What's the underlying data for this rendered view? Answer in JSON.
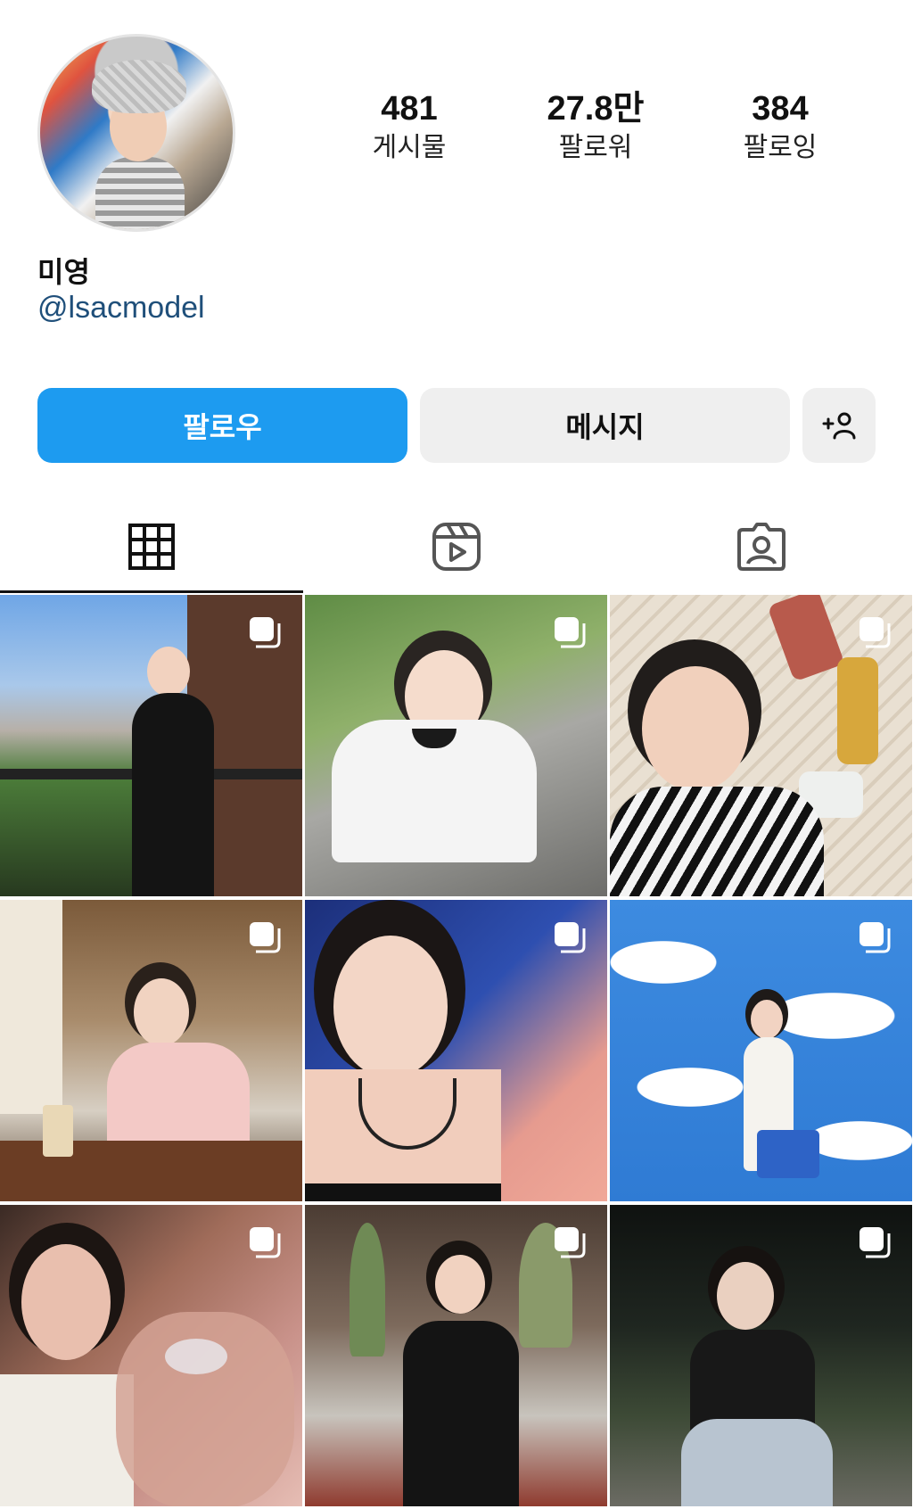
{
  "profile": {
    "name": "미영",
    "handle": "@lsacmodel",
    "avatar_icon": "profile-photo"
  },
  "stats": [
    {
      "value": "481",
      "label": "게시물"
    },
    {
      "value": "27.8만",
      "label": "팔로워"
    },
    {
      "value": "384",
      "label": "팔로잉"
    }
  ],
  "buttons": {
    "follow": "팔로우",
    "message": "메시지",
    "add_user_icon": "person-add-icon"
  },
  "tabs": [
    {
      "icon": "grid-icon",
      "active": true
    },
    {
      "icon": "reels-icon",
      "active": false
    },
    {
      "icon": "tagged-icon",
      "active": false
    }
  ],
  "colors": {
    "follow_bg": "#1d9bf0",
    "handle": "#1f4f7a",
    "secondary_bg": "#efefef"
  },
  "posts": [
    {
      "multi": true,
      "scene": "balcony-city-black-dress"
    },
    {
      "multi": true,
      "scene": "street-white-tee-smile"
    },
    {
      "multi": true,
      "scene": "wink-striped-with-bottles"
    },
    {
      "multi": true,
      "scene": "cafe-pink-dress"
    },
    {
      "multi": true,
      "scene": "blue-closeup-necklace"
    },
    {
      "multi": true,
      "scene": "clouds-room-white-dress"
    },
    {
      "multi": true,
      "scene": "blurry-close-selfie"
    },
    {
      "multi": true,
      "scene": "sitting-black-dress-plants"
    },
    {
      "multi": true,
      "scene": "night-squat-black-tee"
    }
  ]
}
